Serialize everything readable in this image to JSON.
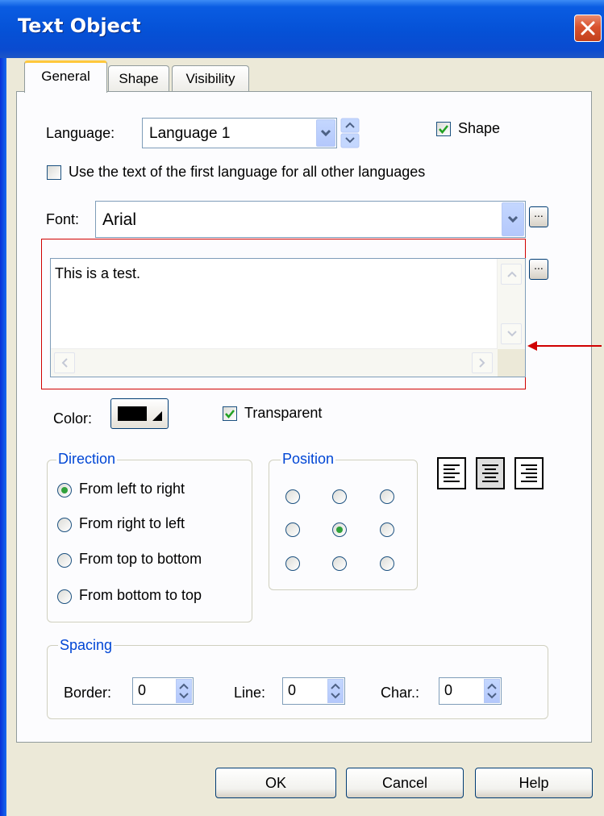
{
  "window": {
    "title": "Text Object"
  },
  "tabs": [
    {
      "label": "General",
      "active": true
    },
    {
      "label": "Shape",
      "active": false
    },
    {
      "label": "Visibility",
      "active": false
    }
  ],
  "language": {
    "label": "Language:",
    "value": "Language 1"
  },
  "shape_checkbox": {
    "label": "Shape",
    "checked": true
  },
  "use_first_language": {
    "label": "Use the text of the first language for all other languages",
    "checked": false
  },
  "font": {
    "label": "Font:",
    "value": "Arial",
    "button": "..."
  },
  "text_box": {
    "value": "This is a test.",
    "button": "..."
  },
  "color": {
    "label": "Color:",
    "value": "#000000"
  },
  "transparent": {
    "label": "Transparent",
    "checked": true
  },
  "direction": {
    "title": "Direction",
    "options": [
      "From left to right",
      "From right to left",
      "From top to bottom",
      "From bottom to top"
    ],
    "selected": 0
  },
  "position": {
    "title": "Position",
    "selected_row": 1,
    "selected_col": 1
  },
  "alignment": {
    "icons": [
      "align-left-icon",
      "align-center-icon",
      "align-right-icon"
    ]
  },
  "spacing": {
    "title": "Spacing",
    "border": {
      "label": "Border:",
      "value": "0"
    },
    "line": {
      "label": "Line:",
      "value": "0"
    },
    "char": {
      "label": "Char.:",
      "value": "0"
    }
  },
  "buttons": {
    "ok": "OK",
    "cancel": "Cancel",
    "help": "Help"
  },
  "colors": {
    "annotation": "#d00000",
    "accent": "#0046d5"
  }
}
